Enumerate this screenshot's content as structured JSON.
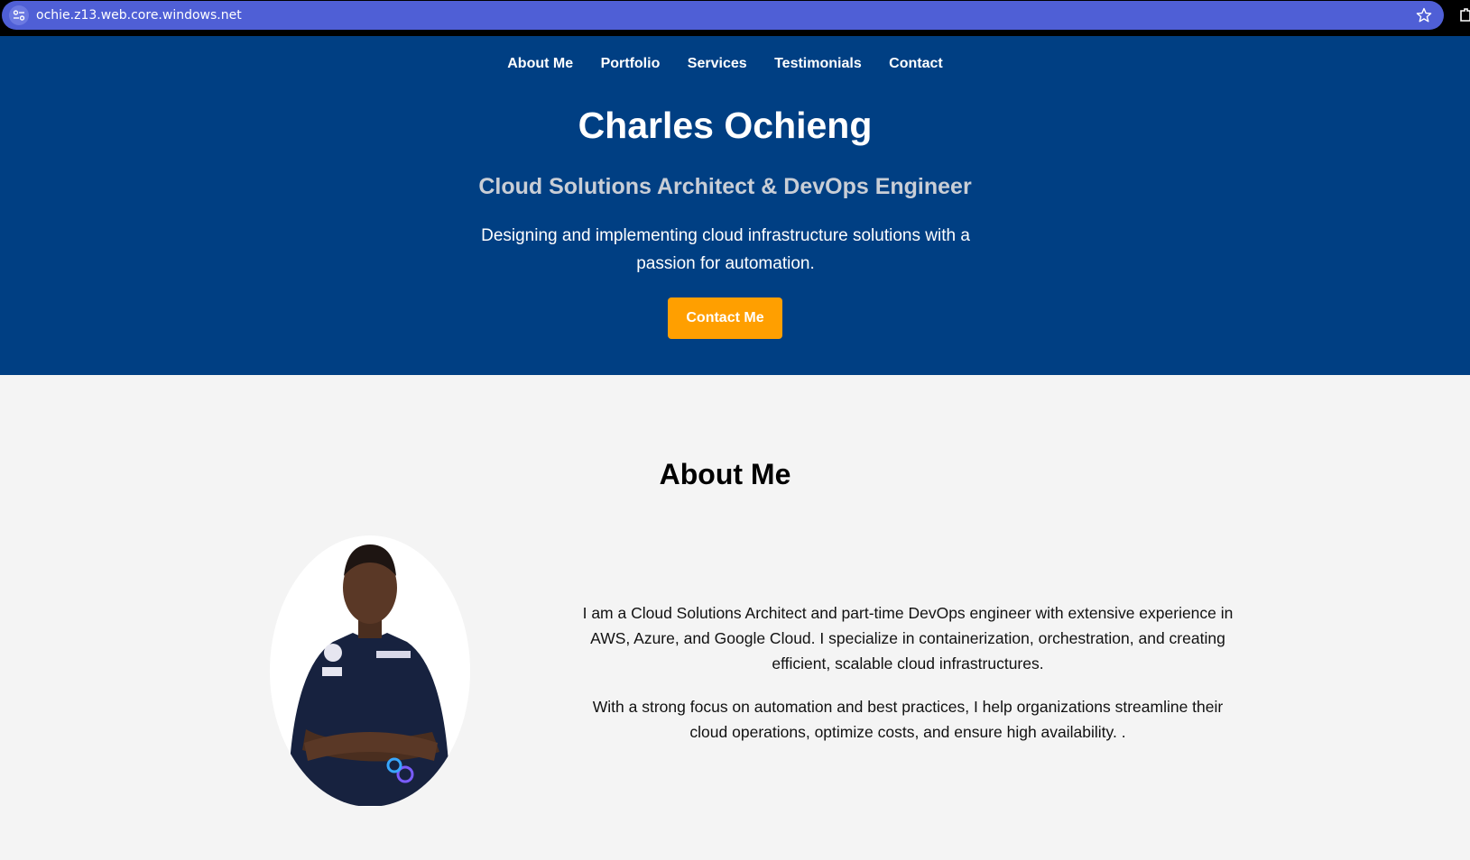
{
  "browser": {
    "url": "ochie.z13.web.core.windows.net"
  },
  "nav": {
    "items": [
      {
        "label": "About Me"
      },
      {
        "label": "Portfolio"
      },
      {
        "label": "Services"
      },
      {
        "label": "Testimonials"
      },
      {
        "label": "Contact"
      }
    ]
  },
  "hero": {
    "name": "Charles Ochieng",
    "subtitle": "Cloud Solutions Architect & DevOps Engineer",
    "tagline": "Designing and implementing cloud infrastructure solutions with a passion for automation.",
    "cta_label": "Contact Me"
  },
  "about": {
    "heading": "About Me",
    "paragraphs": [
      "I am a Cloud Solutions Architect and part-time DevOps engineer with extensive experience in AWS, Azure, and Google Cloud. I specialize in containerization, orchestration, and creating efficient, scalable cloud infrastructures.",
      "With a strong focus on automation and best practices, I help organizations streamline their cloud operations, optimize costs, and ensure high availability. ."
    ],
    "photo_icon": "profile-photo"
  },
  "colors": {
    "address_bar": "#4f5fd6",
    "hero_bg": "#003f83",
    "cta": "#ff9f00",
    "about_bg": "#f4f4f4"
  }
}
